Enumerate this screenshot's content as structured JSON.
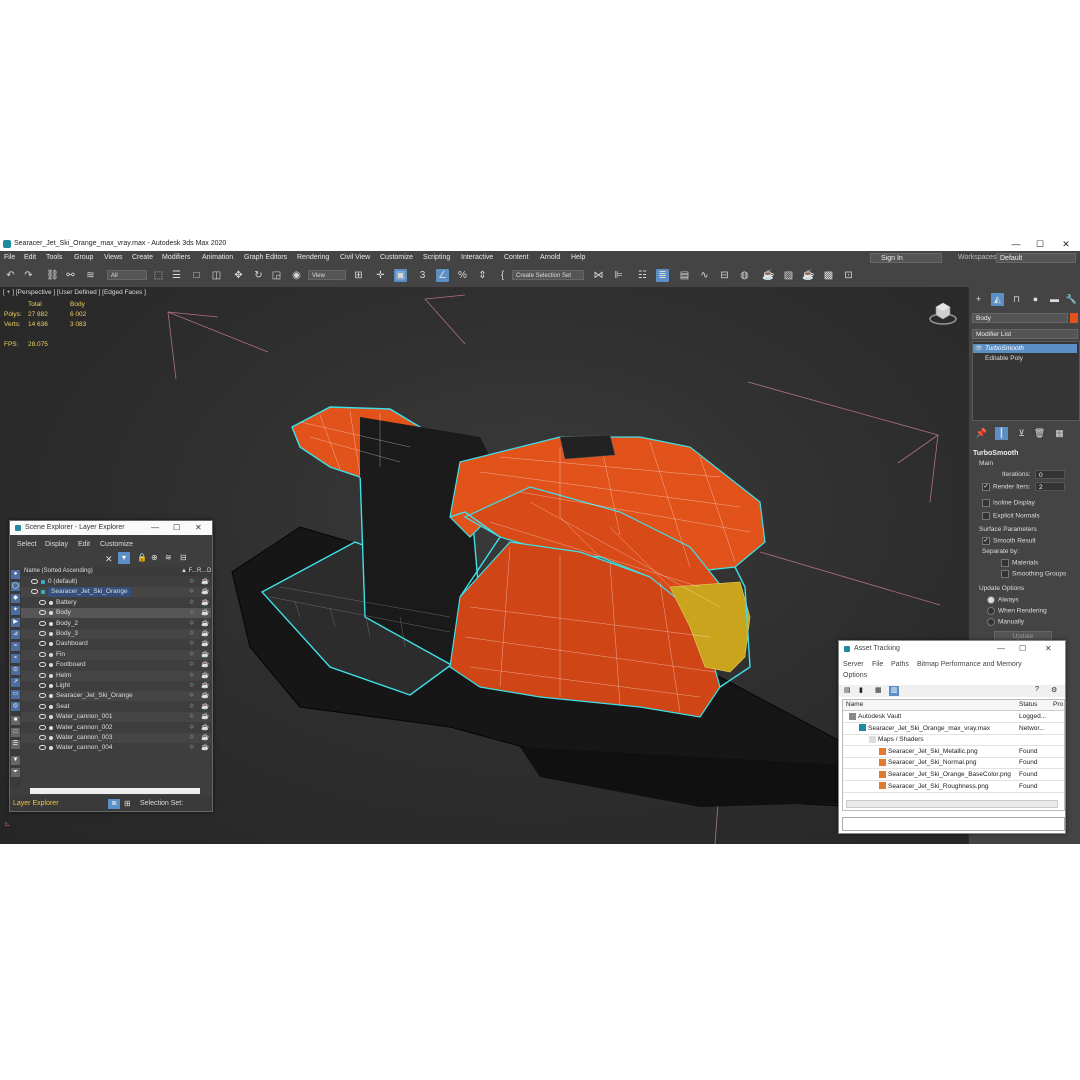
{
  "window": {
    "title": "Searacer_Jet_Ski_Orange_max_vray.max - Autodesk 3ds Max 2020",
    "controls": [
      "—",
      "☐",
      "✕"
    ]
  },
  "menu": [
    "File",
    "Edit",
    "Tools",
    "Group",
    "Views",
    "Create",
    "Modifiers",
    "Animation",
    "Graph Editors",
    "Rendering",
    "Civil View",
    "Customize",
    "Scripting",
    "Interactive",
    "Content",
    "Arnold",
    "Help"
  ],
  "signin": "Sign In",
  "workspaces": {
    "label": "Workspaces:",
    "value": "Default"
  },
  "toolbar": {
    "filter": "All",
    "refcoord": "View",
    "selection_set": "Create Selection Set"
  },
  "viewport": {
    "label": "[ + ] [Perspective ] [User Defined ] [Edged Faces ]",
    "stats": {
      "col_total": "Total",
      "col_body": "Body",
      "polys_label": "Polys:",
      "polys_total": "27 882",
      "polys_body": "6 002",
      "verts_label": "Verts:",
      "verts_total": "14 636",
      "verts_body": "3 083",
      "fps_label": "FPS:",
      "fps_value": "28.075"
    }
  },
  "command_panel": {
    "object_name": "Body",
    "modifier_list": "Modifier List",
    "stack": [
      "TurboSmooth",
      "Editable Poly"
    ],
    "rollout_title": "TurboSmooth",
    "main": "Main",
    "iterations_label": "Iterations:",
    "iterations_value": "0",
    "render_iters_label": "Render Iters:",
    "render_iters_value": "2",
    "isoline": "Isoline Display",
    "explicit_normals": "Explicit Normals",
    "surface_params": "Surface Parameters",
    "smooth_result": "Smooth Result",
    "separate_by": "Separate by:",
    "materials": "Materials",
    "smoothing_groups": "Smoothing Groups",
    "update_options": "Update Options",
    "always": "Always",
    "when_rendering": "When Rendering",
    "manually": "Manually",
    "update": "Update"
  },
  "scene_explorer": {
    "title": "Scene Explorer - Layer Explorer",
    "menu": [
      "Select",
      "Display",
      "Edit",
      "Customize"
    ],
    "col_name": "Name (Sorted Ascending)",
    "col_f": "▲ F...",
    "col_r": "R...",
    "col_d": "D",
    "rows": [
      {
        "label": "0 (default)",
        "level": 1
      },
      {
        "label": "Searacer_Jet_Ski_Orange",
        "level": 1
      },
      {
        "label": "Battery",
        "level": 2
      },
      {
        "label": "Body",
        "level": 2
      },
      {
        "label": "Body_2",
        "level": 2
      },
      {
        "label": "Body_3",
        "level": 2
      },
      {
        "label": "Dashboard",
        "level": 2
      },
      {
        "label": "Fin",
        "level": 2
      },
      {
        "label": "Footboard",
        "level": 2
      },
      {
        "label": "Helm",
        "level": 2
      },
      {
        "label": "Light",
        "level": 2
      },
      {
        "label": "Searacer_Jet_Ski_Orange",
        "level": 2
      },
      {
        "label": "Seat",
        "level": 2
      },
      {
        "label": "Water_cannon_001",
        "level": 2
      },
      {
        "label": "Water_cannon_002",
        "level": 2
      },
      {
        "label": "Water_cannon_003",
        "level": 2
      },
      {
        "label": "Water_cannon_004",
        "level": 2
      }
    ],
    "footer_layer": "Layer Explorer",
    "footer_selset": "Selection Set:"
  },
  "asset_tracking": {
    "title": "Asset Tracking",
    "menu": [
      "Server",
      "File",
      "Paths",
      "Bitmap Performance and Memory",
      "Options"
    ],
    "col_name": "Name",
    "col_status": "Status",
    "col_pro": "Pro",
    "rows": [
      {
        "name": "Autodesk Vault",
        "status": "Logged...",
        "level": 0
      },
      {
        "name": "Searacer_Jet_Ski_Orange_max_vray.max",
        "status": "Networ...",
        "level": 1
      },
      {
        "name": "Maps / Shaders",
        "status": "",
        "level": 2
      },
      {
        "name": "Searacer_Jet_Ski_Metallic.png",
        "status": "Found",
        "level": 3
      },
      {
        "name": "Searacer_Jet_Ski_Normal.png",
        "status": "Found",
        "level": 3
      },
      {
        "name": "Searacer_Jet_Ski_Orange_BaseColor.png",
        "status": "Found",
        "level": 3
      },
      {
        "name": "Searacer_Jet_Ski_Roughness.png",
        "status": "Found",
        "level": 3
      }
    ]
  },
  "colors": {
    "accent": "#5b8fc5",
    "stats": "#f0d060",
    "selection_outline": "#3ee0e8",
    "orange": "#e2531c"
  }
}
